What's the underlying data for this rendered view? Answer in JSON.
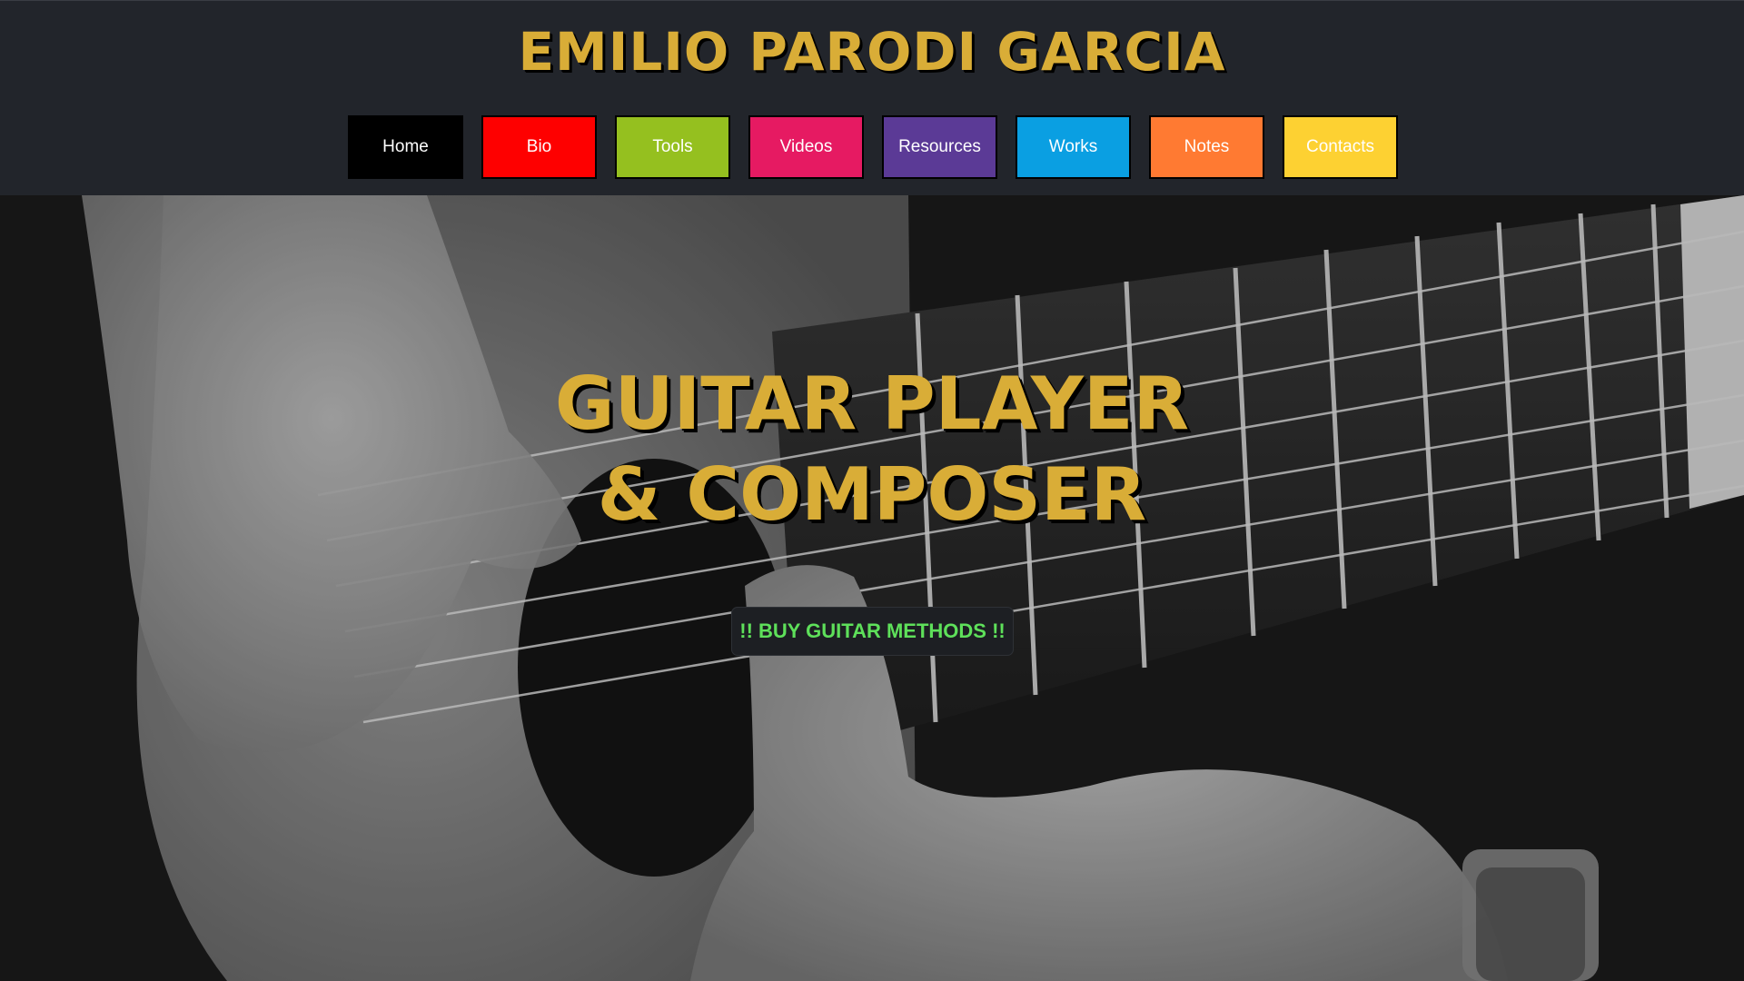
{
  "site": {
    "title": "EMILIO PARODI GARCIA"
  },
  "nav": {
    "items": [
      {
        "label": "Home",
        "color": "#000000"
      },
      {
        "label": "Bio",
        "color": "#fe0000"
      },
      {
        "label": "Tools",
        "color": "#95c01f"
      },
      {
        "label": "Videos",
        "color": "#e61a62"
      },
      {
        "label": "Resources",
        "color": "#5b3a96"
      },
      {
        "label": "Works",
        "color": "#0a9fe2"
      },
      {
        "label": "Notes",
        "color": "#ff7a32"
      },
      {
        "label": "Contacts",
        "color": "#fdd132"
      }
    ]
  },
  "hero": {
    "title_line1": "GUITAR PLAYER",
    "title_line2": "& COMPOSER",
    "button_label": "!! BUY GUITAR METHODS !!",
    "image": "black-and-white photo of hands playing an acoustic guitar"
  },
  "colors": {
    "header_bg": "#22252b",
    "title_gold": "#d9ad37",
    "button_text": "#5ee05a"
  }
}
